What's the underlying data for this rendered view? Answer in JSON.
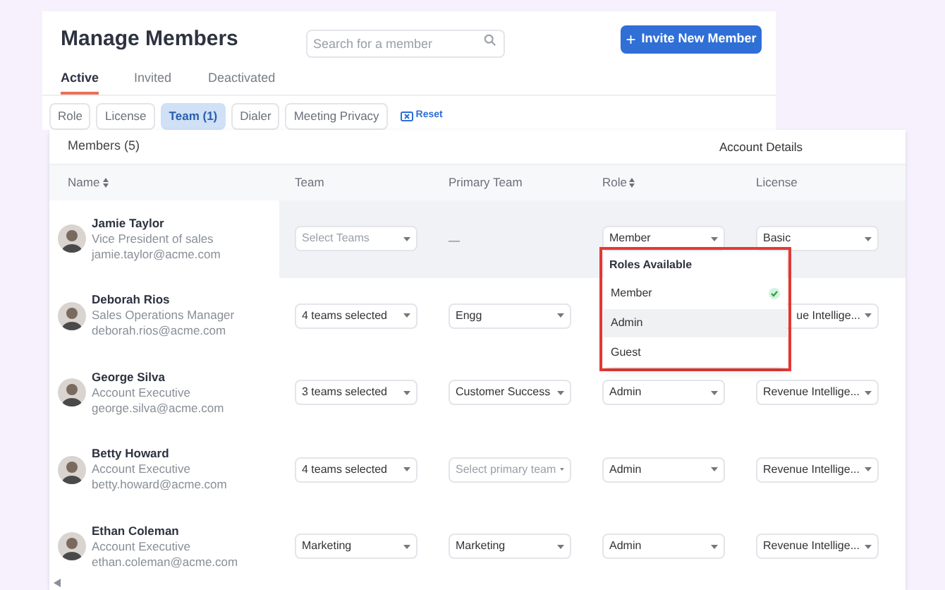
{
  "header": {
    "title": "Manage Members",
    "search": {
      "placeholder": "Search for a member"
    },
    "invite_button": {
      "icon": "+",
      "label": "Invite New Member"
    }
  },
  "tabs": [
    {
      "label": "Active",
      "selected": true
    },
    {
      "label": "Invited",
      "selected": false
    },
    {
      "label": "Deactivated",
      "selected": false
    }
  ],
  "filters": [
    {
      "label": "Role",
      "selected": false
    },
    {
      "label": "License",
      "selected": false
    },
    {
      "label": "Team (1)",
      "selected": true
    },
    {
      "label": "Dialer",
      "selected": false
    },
    {
      "label": "Meeting Privacy",
      "selected": false
    }
  ],
  "reset": "Reset",
  "table": {
    "members_label": "Members (5)",
    "group_label": "Account Details",
    "columns": [
      {
        "label": "Name",
        "sortable": true
      },
      {
        "label": "Team",
        "sortable": false
      },
      {
        "label": "Primary Team",
        "sortable": false
      },
      {
        "label": "Role",
        "sortable": true
      },
      {
        "label": "License",
        "sortable": false
      }
    ],
    "rows": [
      {
        "selected": true,
        "cells": [
          {
            "kind": "member",
            "name": "Jamie Taylor",
            "title": "Vice President of sales",
            "email": "jamie.taylor@acme.com"
          },
          {
            "kind": "dropdown",
            "placeholder": "Select Teams"
          },
          {
            "kind": "dash",
            "text": "—"
          },
          {
            "kind": "dropdown",
            "value": "Member"
          },
          {
            "kind": "dropdown",
            "value": "Basic"
          }
        ]
      },
      {
        "selected": false,
        "cells": [
          {
            "kind": "member",
            "name": "Deborah Rios",
            "title": "Sales Operations Manager",
            "email": "deborah.rios@acme.com"
          },
          {
            "kind": "dropdown",
            "value": "4 teams selected"
          },
          {
            "kind": "dropdown",
            "value": "Engg"
          },
          {
            "kind": "hidden"
          },
          {
            "kind": "dropdown",
            "value": "ue Intellige...",
            "clipped_start": true
          }
        ]
      },
      {
        "selected": false,
        "cells": [
          {
            "kind": "member",
            "name": "George Silva",
            "title": "Account Executive",
            "email": "george.silva@acme.com"
          },
          {
            "kind": "dropdown",
            "value": "3 teams selected"
          },
          {
            "kind": "dropdown",
            "value": "Customer Success"
          },
          {
            "kind": "dropdown",
            "value": "Admin"
          },
          {
            "kind": "dropdown",
            "value": "Revenue Intellige..."
          }
        ]
      },
      {
        "selected": false,
        "cells": [
          {
            "kind": "member",
            "name": "Betty Howard",
            "title": "Account Executive",
            "email": "betty.howard@acme.com"
          },
          {
            "kind": "dropdown",
            "value": "4 teams selected"
          },
          {
            "kind": "dropdown",
            "placeholder": "Select primary team"
          },
          {
            "kind": "dropdown",
            "value": "Admin"
          },
          {
            "kind": "dropdown",
            "value": "Revenue Intellige..."
          }
        ]
      },
      {
        "selected": false,
        "cells": [
          {
            "kind": "member",
            "name": "Ethan Coleman",
            "title": "Account Executive",
            "email": "ethan.coleman@acme.com"
          },
          {
            "kind": "dropdown",
            "value": "Marketing"
          },
          {
            "kind": "dropdown",
            "value": "Marketing"
          },
          {
            "kind": "dropdown",
            "value": "Admin"
          },
          {
            "kind": "dropdown",
            "value": "Revenue Intellige..."
          }
        ]
      }
    ]
  },
  "role_menu": {
    "title": "Roles Available",
    "items": [
      {
        "label": "Member",
        "selected": true,
        "highlighted": false
      },
      {
        "label": "Admin",
        "selected": false,
        "highlighted": true
      },
      {
        "label": "Guest",
        "selected": false,
        "highlighted": false
      }
    ]
  }
}
